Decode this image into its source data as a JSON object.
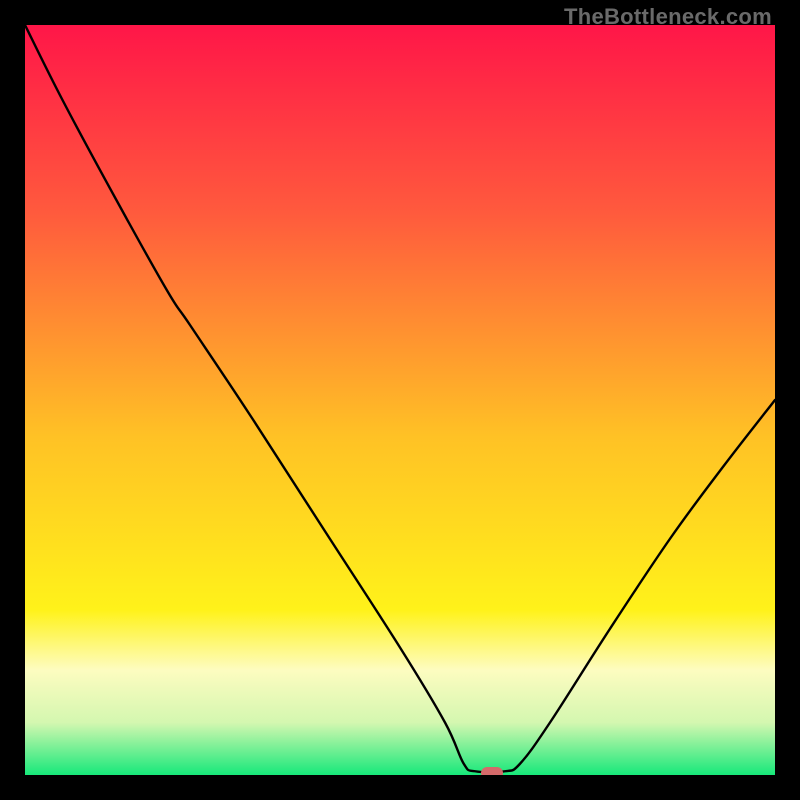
{
  "watermark": "TheBottleneck.com",
  "marker": {
    "color": "#d46a6a",
    "x_frac": 0.623,
    "y_frac": 0.997
  },
  "chart_data": {
    "type": "line",
    "title": "",
    "xlabel": "",
    "ylabel": "",
    "xlim": [
      0,
      1
    ],
    "ylim": [
      0,
      1
    ],
    "gradient_stops": [
      {
        "offset": 0,
        "color": "#ff1648"
      },
      {
        "offset": 0.25,
        "color": "#ff5a3d"
      },
      {
        "offset": 0.55,
        "color": "#ffc225"
      },
      {
        "offset": 0.78,
        "color": "#fff21a"
      },
      {
        "offset": 0.86,
        "color": "#fdfcc0"
      },
      {
        "offset": 0.93,
        "color": "#d4f7b0"
      },
      {
        "offset": 1,
        "color": "#17e87a"
      }
    ],
    "series": [
      {
        "name": "bottleneck-curve",
        "x": [
          0.0,
          0.05,
          0.12,
          0.19,
          0.22,
          0.3,
          0.4,
          0.5,
          0.56,
          0.585,
          0.6,
          0.64,
          0.66,
          0.7,
          0.78,
          0.86,
          0.93,
          1.0
        ],
        "y": [
          1.0,
          0.9,
          0.77,
          0.645,
          0.6,
          0.48,
          0.325,
          0.17,
          0.07,
          0.015,
          0.005,
          0.005,
          0.015,
          0.07,
          0.195,
          0.315,
          0.41,
          0.5
        ]
      }
    ],
    "annotations": []
  }
}
